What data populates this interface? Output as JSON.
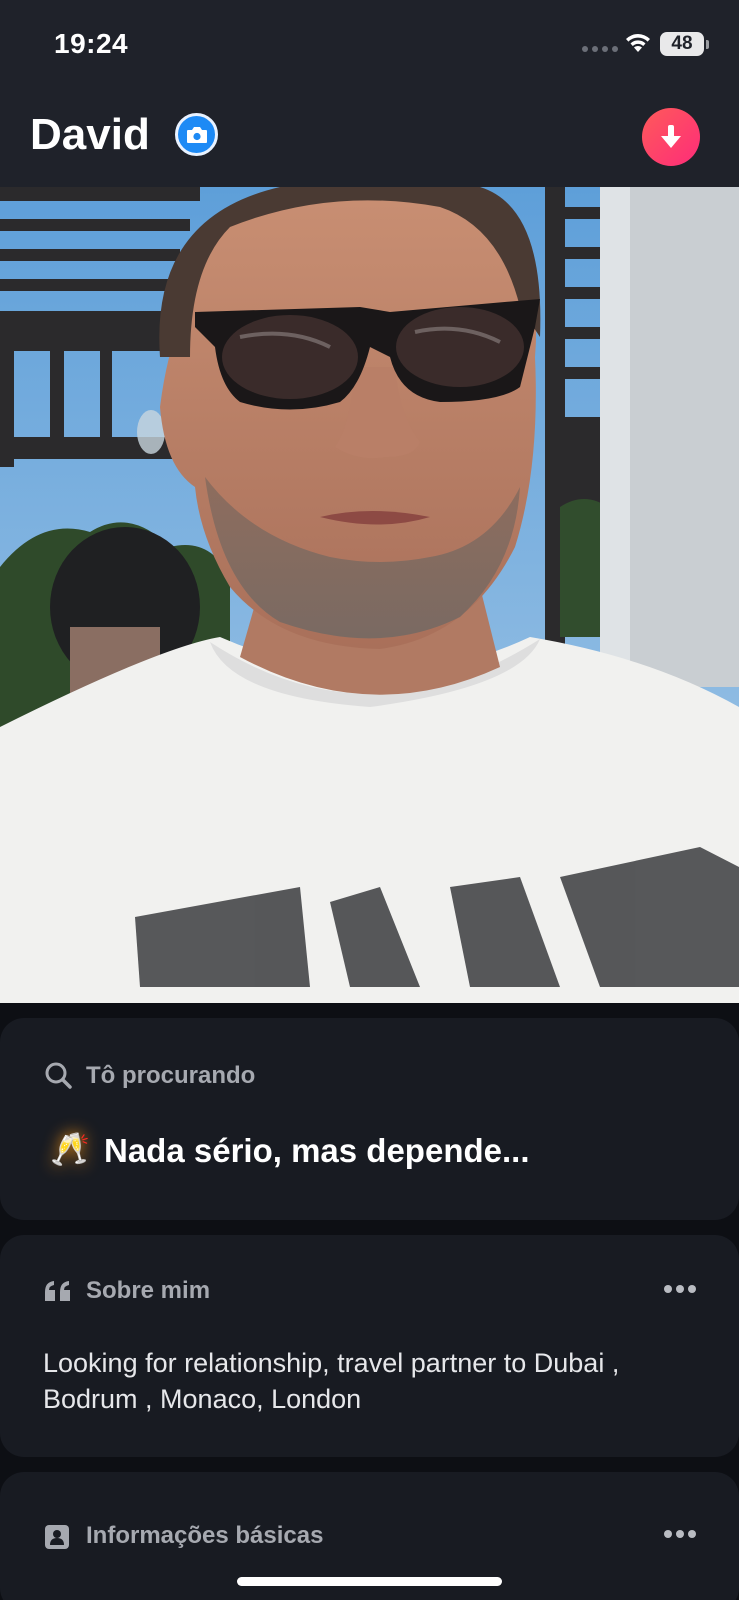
{
  "status_bar": {
    "time": "19:24",
    "battery": "48"
  },
  "header": {
    "name": "David",
    "verified_icon": "camera-icon",
    "action_icon": "arrow-down-icon"
  },
  "photo": {
    "subject": "profile-photo"
  },
  "looking_for": {
    "label": "Tô procurando",
    "icon": "search-icon",
    "emoji": "🥂",
    "value": "Nada sério, mas depende..."
  },
  "about": {
    "label": "Sobre mim",
    "icon": "quote-icon",
    "text": "Looking for relationship, travel partner to Dubai , Bodrum , Monaco, London"
  },
  "basic_info": {
    "label": "Informações básicas",
    "icon": "id-badge-icon"
  },
  "colors": {
    "accent": "#fd2c79",
    "verified": "#1d8af5",
    "card": "#181b22"
  }
}
